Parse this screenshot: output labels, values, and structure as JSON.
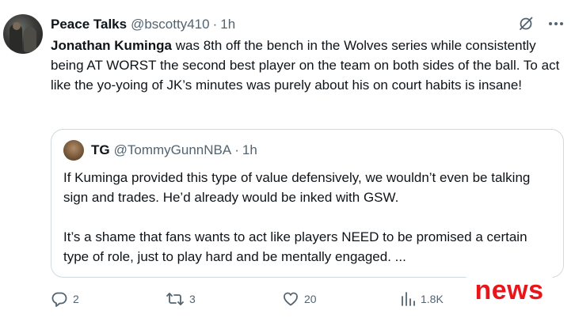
{
  "author": {
    "display_name": "Peace Talks",
    "handle": "@bscotty410",
    "separator": "·",
    "time": "1h"
  },
  "tweet": {
    "mention": "Jonathan Kuminga",
    "text_after_mention": " was 8th off the bench in the Wolves series while consistently being AT WORST the second best player on the team on both sides of the ball. To act like the yo-yoing of JK’s minutes was purely about his on court habits is insane!"
  },
  "quote": {
    "display_name": "TG",
    "handle": "@TommyGunnNBA",
    "separator": "·",
    "time": "1h",
    "paragraph1": "If Kuminga provided this type of value defensively, we wouldn’t even be talking sign and trades. He’d already would be inked with GSW.",
    "paragraph2": "It’s a shame that fans wants to act like players NEED to be promised a certain type of role, just to play hard and be mentally engaged. ..."
  },
  "actions": {
    "replies": "2",
    "reposts": "3",
    "likes": "20",
    "views": "1.8K"
  },
  "watermark": {
    "text": "news",
    "color": "#e8151b"
  },
  "icons": {
    "header": [
      "grok-icon",
      "more-icon"
    ],
    "actions": [
      "reply-icon",
      "repost-icon",
      "like-icon",
      "views-icon"
    ]
  },
  "colors": {
    "text_primary": "#0f1419",
    "text_secondary": "#536471",
    "border": "#cfd9de"
  }
}
